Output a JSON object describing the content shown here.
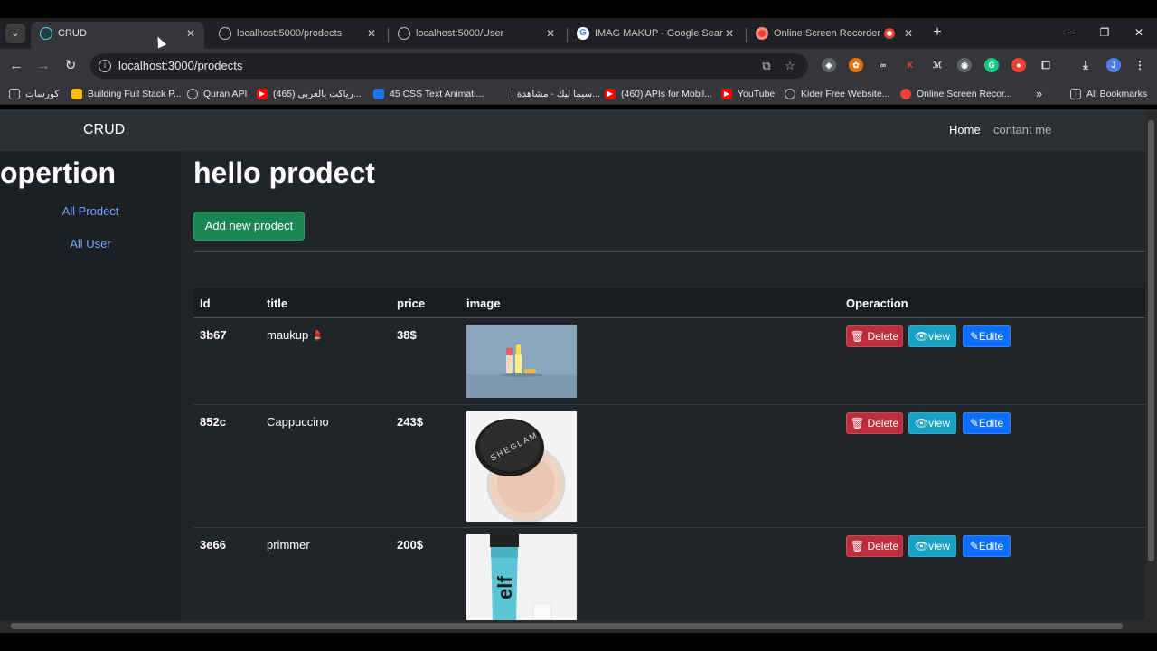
{
  "browser": {
    "tabs": [
      {
        "title": "CRUD",
        "icon": "react-icon",
        "active": true
      },
      {
        "title": "localhost:5000/prodects",
        "icon": "globe-icon"
      },
      {
        "title": "localhost:5000/User",
        "icon": "globe-icon"
      },
      {
        "title": "IMAG MAKUP - Google Search",
        "icon": "google-icon"
      },
      {
        "title": "Online Screen Recorder",
        "icon": "recorder-icon"
      }
    ],
    "tab_close_glyph": "✕",
    "new_tab_glyph": "+",
    "url": "localhost:3000/prodects",
    "bookmarks": [
      {
        "label": "كورسات",
        "icon": "folder-icon"
      },
      {
        "label": "Building Full Stack P...",
        "icon": "bookmark-icon"
      },
      {
        "label": "Quran API",
        "icon": "globe-icon"
      },
      {
        "label": "(465) رياكت بالعربى...",
        "icon": "youtube-icon"
      },
      {
        "label": "45 CSS Text Animati...",
        "icon": "site-icon"
      },
      {
        "label": "سيما ليك - مشاهدة ا...",
        "icon": "site-icon"
      },
      {
        "label": "(460) APIs for Mobil...",
        "icon": "youtube-icon"
      },
      {
        "label": "YouTube",
        "icon": "youtube-icon"
      },
      {
        "label": "Kider Free Website...",
        "icon": "globe-icon"
      },
      {
        "label": "Online Screen Recor...",
        "icon": "recorder-icon"
      }
    ],
    "more_bookmarks_glyph": "»",
    "all_bookmarks": "All Bookmarks",
    "profile_initial": "J"
  },
  "app": {
    "brand": "CRUD",
    "nav": {
      "home": "Home",
      "contact": "contant me"
    },
    "sidebar": {
      "title": "opertion",
      "links": [
        "All Prodect",
        "All User"
      ]
    },
    "main": {
      "title": "hello prodect",
      "add_button": "Add new prodect"
    },
    "table": {
      "headers": {
        "id": "Id",
        "title": "title",
        "price": "price",
        "image": "image",
        "operation": "Operaction"
      },
      "rows": [
        {
          "id": "3b67",
          "title": "maukup",
          "emoji": "💄",
          "price": "38$",
          "image": "lipstick-product-photo"
        },
        {
          "id": "852c",
          "title": "Cappuccino",
          "emoji": "",
          "price": "243$",
          "image": "sheglam-powder-photo"
        },
        {
          "id": "3e66",
          "title": "primmer",
          "emoji": "",
          "price": "200$",
          "image": "elf-primer-photo"
        }
      ],
      "buttons": {
        "delete": "Delete",
        "view": "view",
        "edit": "Edite"
      }
    }
  },
  "colors": {
    "delete": "#bb2d3b",
    "view": "#17a2c5",
    "edit": "#0d6efd",
    "add": "#198754",
    "link": "#6ea8fe"
  }
}
